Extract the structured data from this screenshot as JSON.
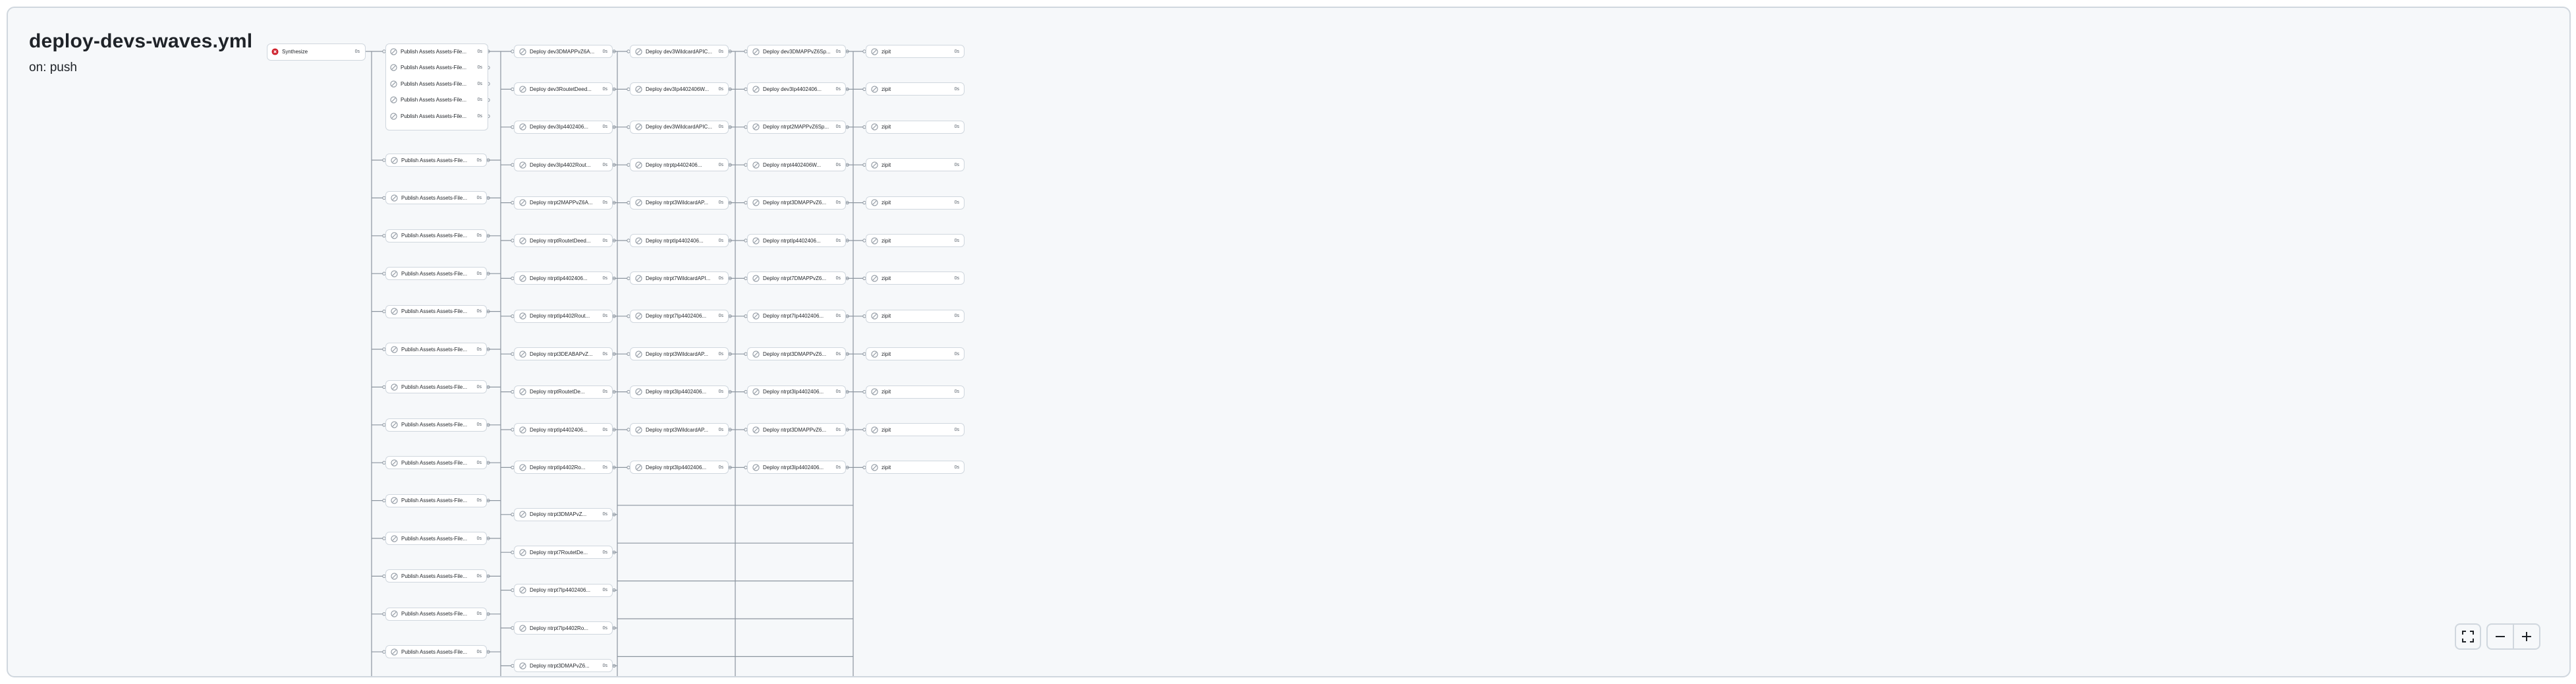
{
  "workflow": {
    "title": "deploy-devs-waves.yml",
    "trigger": "on: push"
  },
  "colors": {
    "failed": "#cf222e",
    "skipped": "#8c959f"
  },
  "jobs": {
    "synthesize": {
      "name": "Synthesize",
      "duration": "0s",
      "status": "failed",
      "icon": "x-circle-icon"
    },
    "publish": [
      {
        "name": "Publish Assets Assets-File...",
        "duration": "0s"
      },
      {
        "name": "Publish Assets Assets-File...",
        "duration": "0s"
      },
      {
        "name": "Publish Assets Assets-File...",
        "duration": "0s"
      },
      {
        "name": "Publish Assets Assets-File...",
        "duration": "0s"
      },
      {
        "name": "Publish Assets Assets-File...",
        "duration": "0s"
      },
      {
        "name": "Publish Assets Assets-File...",
        "duration": "0s"
      },
      {
        "name": "Publish Assets Assets-File...",
        "duration": "0s"
      },
      {
        "name": "Publish Assets Assets-File...",
        "duration": "0s"
      },
      {
        "name": "Publish Assets Assets-File...",
        "duration": "0s"
      },
      {
        "name": "Publish Assets Assets-File...",
        "duration": "0s"
      },
      {
        "name": "Publish Assets Assets-File...",
        "duration": "0s"
      },
      {
        "name": "Publish Assets Assets-File...",
        "duration": "0s"
      },
      {
        "name": "Publish Assets Assets-File...",
        "duration": "0s"
      },
      {
        "name": "Publish Assets Assets-File...",
        "duration": "0s"
      },
      {
        "name": "Publish Assets Assets-File...",
        "duration": "0s"
      },
      {
        "name": "Publish Assets Assets-File...",
        "duration": "0s"
      },
      {
        "name": "Publish Assets Assets-File...",
        "duration": "0s"
      },
      {
        "name": "Publish Assets Assets-File...",
        "duration": "0s"
      },
      {
        "name": "Publish Assets Assets-File...",
        "duration": "0s"
      },
      {
        "name": "Publish Assets Assets-File...",
        "duration": "0s"
      }
    ],
    "wave1": [
      {
        "name": "Deploy dev3DMAPPvZ6A...",
        "duration": "0s"
      },
      {
        "name": "Deploy dev3RoutetDeed...",
        "duration": "0s"
      },
      {
        "name": "Deploy dev3Ip4402406...",
        "duration": "0s"
      },
      {
        "name": "Deploy dev3Ip4402Rout...",
        "duration": "0s"
      },
      {
        "name": "Deploy ntrpt2MAPPvZ6A...",
        "duration": "0s"
      },
      {
        "name": "Deploy ntrptRoutetDeed...",
        "duration": "0s"
      },
      {
        "name": "Deploy ntrptIp4402406...",
        "duration": "0s"
      },
      {
        "name": "Deploy ntrptIp4402Rout...",
        "duration": "0s"
      },
      {
        "name": "Deploy ntrpt3DEABAPvZ...",
        "duration": "0s"
      },
      {
        "name": "Deploy ntrptRoutetDe...",
        "duration": "0s"
      },
      {
        "name": "Deploy ntrptIp4402406...",
        "duration": "0s"
      },
      {
        "name": "Deploy ntrptIp4402Ro...",
        "duration": "0s"
      },
      {
        "name": "Deploy ntrpt3DMAPvZ...",
        "duration": "0s"
      },
      {
        "name": "Deploy ntrpt7RoutetDe...",
        "duration": "0s"
      },
      {
        "name": "Deploy ntrpt7Ip4402406...",
        "duration": "0s"
      },
      {
        "name": "Deploy ntrpt7Ip4402Ro...",
        "duration": "0s"
      },
      {
        "name": "Deploy ntrpt3DMAPvZ6...",
        "duration": "0s"
      }
    ],
    "wave2": [
      {
        "name": "Deploy dev3WildcardAPIC...",
        "duration": "0s"
      },
      {
        "name": "Deploy dev3Ip4402406W...",
        "duration": "0s"
      },
      {
        "name": "Deploy dev3WildcardAPIC...",
        "duration": "0s"
      },
      {
        "name": "Deploy ntrptp4402406...",
        "duration": "0s"
      },
      {
        "name": "Deploy ntrpt3WildcardAP...",
        "duration": "0s"
      },
      {
        "name": "Deploy ntrptIp4402406...",
        "duration": "0s"
      },
      {
        "name": "Deploy ntrpt7WildcardAPI...",
        "duration": "0s"
      },
      {
        "name": "Deploy ntrpt7Ip4402406...",
        "duration": "0s"
      },
      {
        "name": "Deploy ntrpt3WildcardAP...",
        "duration": "0s"
      },
      {
        "name": "Deploy ntrpt3Ip4402406...",
        "duration": "0s"
      },
      {
        "name": "Deploy ntrpt3WildcardAP...",
        "duration": "0s"
      },
      {
        "name": "Deploy ntrpt3Ip4402406...",
        "duration": "0s"
      }
    ],
    "wave3": [
      {
        "name": "Deploy dev3DMAPPvZ6Sp...",
        "duration": "0s"
      },
      {
        "name": "Deploy dev3Ip4402406...",
        "duration": "0s"
      },
      {
        "name": "Deploy ntrpt2MAPPvZ6Sp...",
        "duration": "0s"
      },
      {
        "name": "Deploy ntrpt4402406W...",
        "duration": "0s"
      },
      {
        "name": "Deploy ntrpt3DMAPPvZ6...",
        "duration": "0s"
      },
      {
        "name": "Deploy ntrptIp4402406...",
        "duration": "0s"
      },
      {
        "name": "Deploy ntrpt7DMAPPvZ6...",
        "duration": "0s"
      },
      {
        "name": "Deploy ntrpt7Ip4402406...",
        "duration": "0s"
      },
      {
        "name": "Deploy ntrpt3DMAPPvZ6...",
        "duration": "0s"
      },
      {
        "name": "Deploy ntrpt3Ip4402406...",
        "duration": "0s"
      },
      {
        "name": "Deploy ntrpt3DMAPPvZ6...",
        "duration": "0s"
      },
      {
        "name": "Deploy ntrpt3Ip4402406...",
        "duration": "0s"
      }
    ],
    "final": [
      {
        "name": "zipit",
        "duration": "0s"
      },
      {
        "name": "zipit",
        "duration": "0s"
      },
      {
        "name": "zipit",
        "duration": "0s"
      },
      {
        "name": "zipit",
        "duration": "0s"
      },
      {
        "name": "zipit",
        "duration": "0s"
      },
      {
        "name": "zipit",
        "duration": "0s"
      },
      {
        "name": "zipit",
        "duration": "0s"
      },
      {
        "name": "zipit",
        "duration": "0s"
      },
      {
        "name": "zipit",
        "duration": "0s"
      },
      {
        "name": "zipit",
        "duration": "0s"
      },
      {
        "name": "zipit",
        "duration": "0s"
      },
      {
        "name": "zipit",
        "duration": "0s"
      }
    ]
  },
  "controls": {
    "fullscreen_icon": "fullscreen-icon",
    "zoom_out_icon": "minus-icon",
    "zoom_in_icon": "plus-icon"
  }
}
